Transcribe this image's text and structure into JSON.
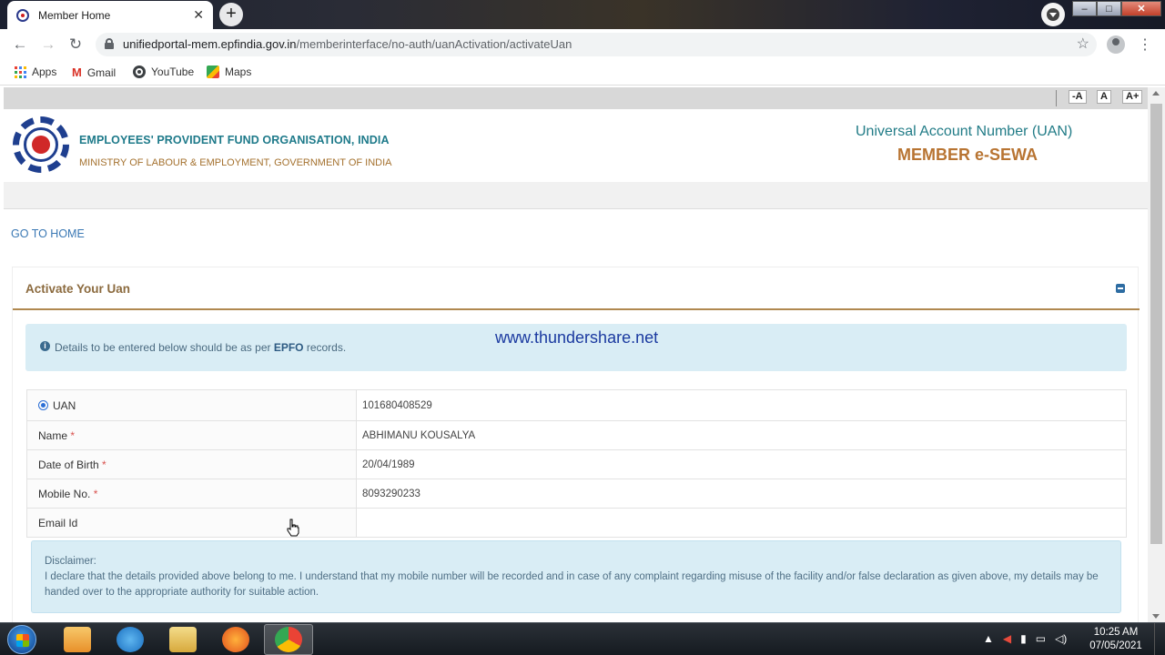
{
  "browser": {
    "tab_title": "Member Home",
    "tab_close": "✕",
    "new_tab": "+",
    "url_host": "unifiedportal-mem.epfindia.gov.in",
    "url_path": "/memberinterface/no-auth/uanActivation/activateUan",
    "bookmarks": [
      "Apps",
      "Gmail",
      "YouTube",
      "Maps"
    ]
  },
  "font_controls": [
    "-A",
    "A",
    "A+"
  ],
  "header": {
    "org_name": "EMPLOYEES' PROVIDENT FUND ORGANISATION, INDIA",
    "org_sub": "MINISTRY OF LABOUR & EMPLOYMENT, GOVERNMENT OF INDIA",
    "uan_title": "Universal Account Number (UAN)",
    "uan_sub": "MEMBER e-SEWA"
  },
  "go_home": "GO TO HOME",
  "panel": {
    "title": "Activate Your Uan",
    "info_prefix": "Details to be entered below should be as per ",
    "info_bold": "EPFO",
    "info_suffix": " records.",
    "watermark": "www.thundershare.net"
  },
  "form": {
    "uan_label": "UAN",
    "uan_value": "101680408529",
    "name_label": "Name",
    "name_value": "ABHIMANU KOUSALYA",
    "dob_label": "Date of Birth",
    "dob_value": "20/04/1989",
    "mobile_label": "Mobile No.",
    "mobile_value": "8093290233",
    "email_label": "Email Id",
    "email_value": "",
    "required_mark": "*"
  },
  "disclaimer": {
    "heading": "Disclaimer:",
    "text": "I declare that the details provided above belong to me. I understand that my mobile number will be recorded and in case of any complaint regarding misuse of the facility and/or false declaration as given above, my details may be handed over to the appropriate authority for suitable action."
  },
  "taskbar": {
    "time": "10:25 AM",
    "date": "07/05/2021"
  }
}
